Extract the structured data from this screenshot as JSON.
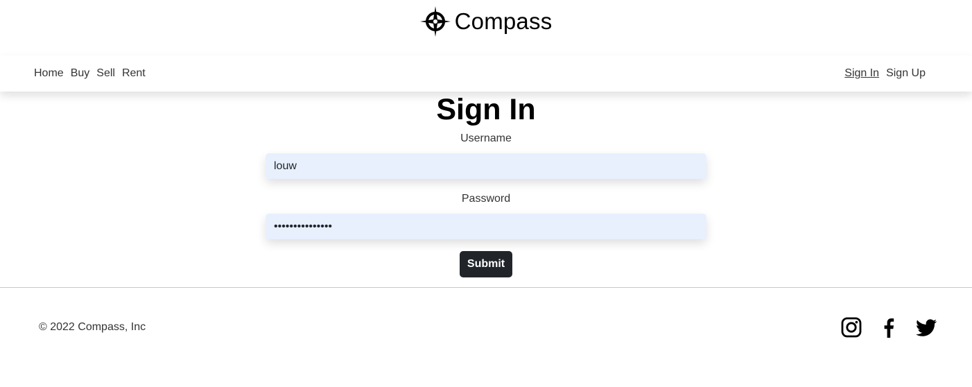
{
  "brand": {
    "name": "Compass",
    "logo_icon": "compass-rose-icon"
  },
  "nav": {
    "left": [
      {
        "label": "Home"
      },
      {
        "label": "Buy"
      },
      {
        "label": "Sell"
      },
      {
        "label": "Rent"
      }
    ],
    "right": [
      {
        "label": "Sign In",
        "active": true
      },
      {
        "label": "Sign Up",
        "active": false
      }
    ]
  },
  "form": {
    "title": "Sign In",
    "username_label": "Username",
    "username_value": "louw",
    "password_label": "Password",
    "password_value": "•••••••••••••••",
    "submit_label": "Submit",
    "field_color": "#e8f0fe",
    "button_color": "#212529"
  },
  "footer": {
    "copyright": "© 2022 Compass, Inc",
    "social_icons": [
      "instagram-icon",
      "facebook-icon",
      "twitter-icon"
    ]
  }
}
